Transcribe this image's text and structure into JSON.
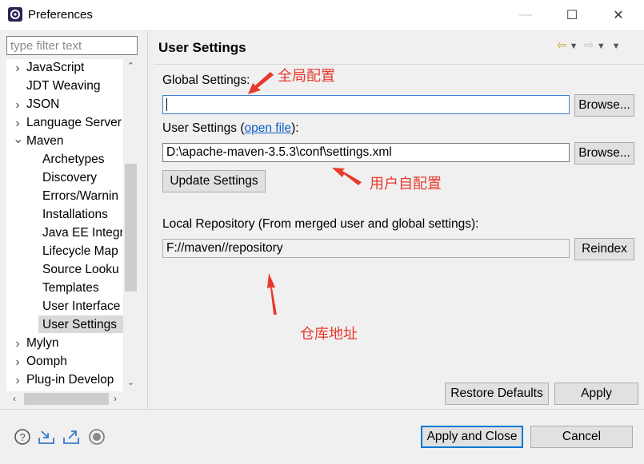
{
  "window": {
    "title": "Preferences",
    "minimize_icon": "—",
    "maximize_icon": "☐",
    "close_icon": "✕"
  },
  "sidebar": {
    "filter_placeholder": "type filter text",
    "items": [
      {
        "label": "JavaScript",
        "twisty": "›"
      },
      {
        "label": "JDT Weaving",
        "twisty": ""
      },
      {
        "label": "JSON",
        "twisty": "›"
      },
      {
        "label": "Language Server",
        "twisty": "›"
      },
      {
        "label": "Maven",
        "twisty": "⌄"
      },
      {
        "label": "Archetypes",
        "twisty": ""
      },
      {
        "label": "Discovery",
        "twisty": ""
      },
      {
        "label": "Errors/Warnin",
        "twisty": ""
      },
      {
        "label": "Installations",
        "twisty": ""
      },
      {
        "label": "Java EE Integra",
        "twisty": ""
      },
      {
        "label": "Lifecycle Map",
        "twisty": ""
      },
      {
        "label": "Source Looku",
        "twisty": ""
      },
      {
        "label": "Templates",
        "twisty": ""
      },
      {
        "label": "User Interface",
        "twisty": ""
      },
      {
        "label": "User Settings",
        "twisty": ""
      },
      {
        "label": "Mylyn",
        "twisty": "›"
      },
      {
        "label": "Oomph",
        "twisty": "›"
      },
      {
        "label": "Plug-in Develop",
        "twisty": "›"
      }
    ],
    "selected": "User Settings"
  },
  "page": {
    "title": "User Settings",
    "nav": "⇦ ▾ ⇨ ▾ ▾",
    "global_label": "Global Settings:",
    "global_value": "",
    "browse_label": "Browse...",
    "user_label_prefix": "User Settings (",
    "user_label_link": "open file",
    "user_label_suffix": "):",
    "user_value": "D:\\apache-maven-3.5.3\\conf\\settings.xml",
    "update_label": "Update Settings",
    "local_label": "Local Repository (From merged user and global settings):",
    "local_value": "F://maven//repository",
    "reindex_label": "Reindex",
    "restore_label": "Restore Defaults",
    "apply_label": "Apply"
  },
  "annotations": {
    "global": "全局配置",
    "user": "用户自配置",
    "repo": "仓库地址",
    "color": "#e8392b"
  },
  "footer": {
    "apply_close_label": "Apply and Close",
    "cancel_label": "Cancel",
    "icons": [
      "help-icon",
      "import-icon",
      "export-icon",
      "record-icon"
    ]
  }
}
